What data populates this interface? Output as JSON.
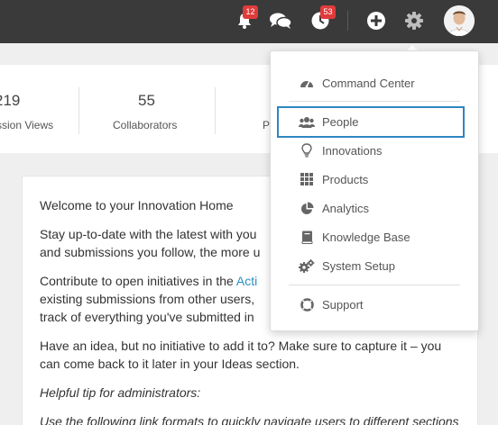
{
  "topbar": {
    "notifications_count": "12",
    "activity_count": "53",
    "icons": [
      "bell-icon",
      "chat-icon",
      "activity-icon",
      "add-icon",
      "gear-icon",
      "user-avatar"
    ]
  },
  "stats": [
    {
      "value": "219",
      "label": "ssion Views"
    },
    {
      "value": "55",
      "label": "Collaborators"
    },
    {
      "value": "",
      "label": "P"
    }
  ],
  "welcome": {
    "title": "Welcome to your Innovation Home",
    "p1_line1": "Stay up-to-date with the latest with you",
    "p1_line2": "and submissions you follow, the more u",
    "p2_line1_a": "Contribute to open initiatives in the ",
    "p2_line1_b": "Acti",
    "p2_line2": "existing submissions from other users,",
    "p2_line3": "track of everything you've submitted in",
    "p3_line1": "Have an idea, but no initiative to add it to? Make sure to capture it – you",
    "p3_line2": "can come back to it later in your Ideas section.",
    "tip_title": "Helpful tip for administrators:",
    "tip_body": "Use the following link formats to quickly navigate users to different sections"
  },
  "menu": {
    "items": [
      {
        "label": "Command Center",
        "icon": "dashboard-icon"
      },
      {
        "label": "People",
        "icon": "people-icon",
        "active": true
      },
      {
        "label": "Innovations",
        "icon": "lightbulb-icon"
      },
      {
        "label": "Products",
        "icon": "grid-icon"
      },
      {
        "label": "Analytics",
        "icon": "pie-chart-icon"
      },
      {
        "label": "Knowledge Base",
        "icon": "book-icon"
      },
      {
        "label": "System Setup",
        "icon": "cogs-icon"
      },
      {
        "label": "Support",
        "icon": "lifebuoy-icon"
      }
    ]
  },
  "colors": {
    "topbar_bg": "#3a3a3a",
    "badge": "#e03b3b",
    "active_border": "#2e86c1",
    "link_accent": "#2a8fc4"
  }
}
